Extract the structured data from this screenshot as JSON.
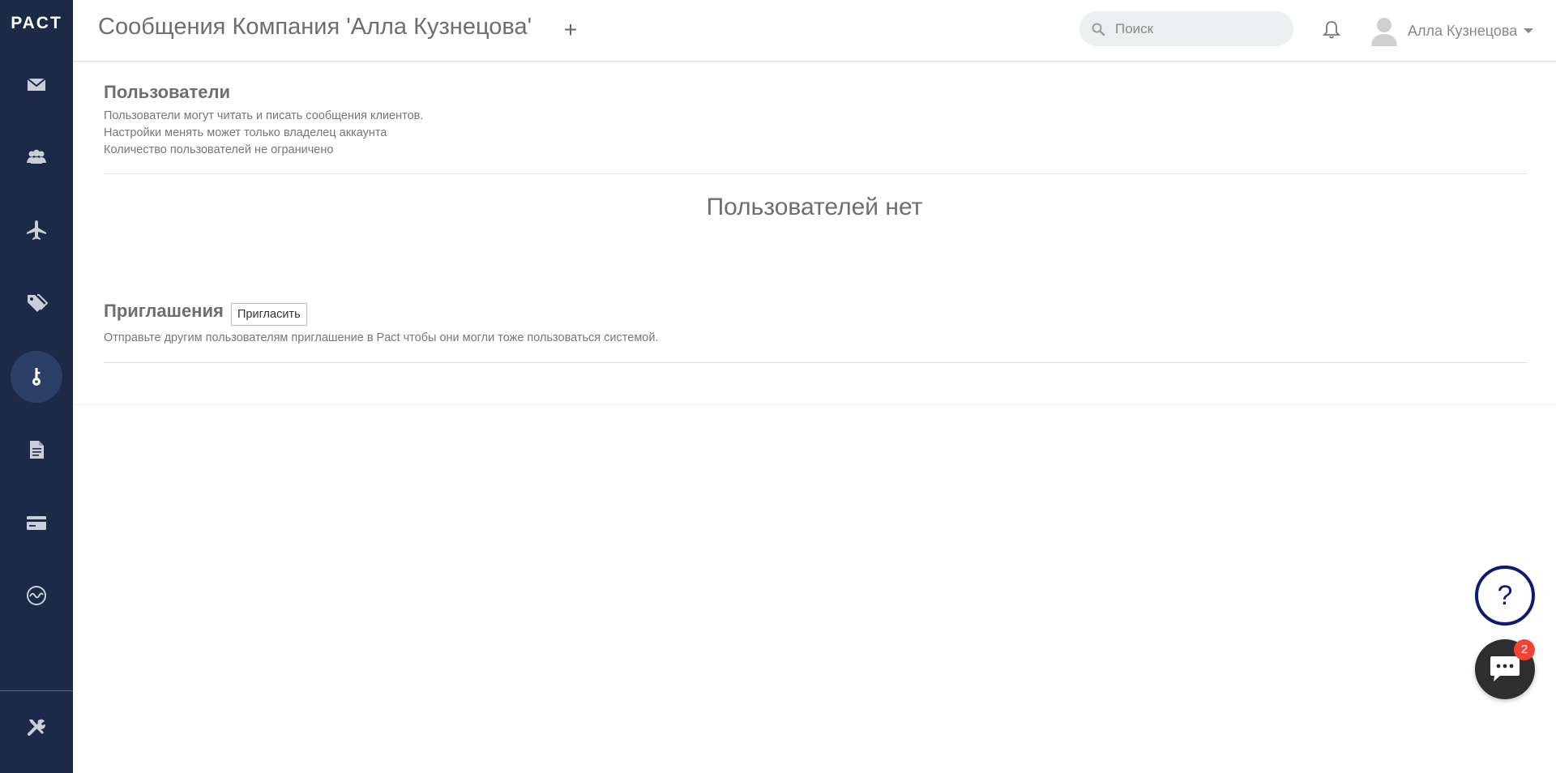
{
  "app": {
    "brand": "PACT"
  },
  "sidebar": {
    "items": [
      {
        "name": "messages",
        "icon": "envelope-icon"
      },
      {
        "name": "clients",
        "icon": "users-icon"
      },
      {
        "name": "channels",
        "icon": "airplane-icon"
      },
      {
        "name": "tags",
        "icon": "tags-icon"
      },
      {
        "name": "access",
        "icon": "key-icon",
        "active": true
      },
      {
        "name": "documents",
        "icon": "document-icon"
      },
      {
        "name": "billing",
        "icon": "credit-card-icon"
      },
      {
        "name": "analytics",
        "icon": "pulse-icon"
      }
    ],
    "bottom_item": {
      "name": "settings",
      "icon": "tools-icon"
    }
  },
  "header": {
    "title": "Сообщения Компания 'Алла Кузнецова'",
    "add_label": "+",
    "search": {
      "placeholder": "Поиск",
      "value": ""
    },
    "user_name": "Алла Кузнецова"
  },
  "users_section": {
    "title": "Пользователи",
    "description": [
      "Пользователи могут читать и писать сообщения клиентов.",
      "Настройки менять может только владелец аккаунта",
      "Количество пользователей не ограничено"
    ],
    "empty_text": "Пользователей нет"
  },
  "invites_section": {
    "title": "Приглашения",
    "invite_button": "Пригласить",
    "description": "Отправьте другим пользователям приглашение в Pact чтобы они могли тоже пользоваться системой."
  },
  "floating": {
    "help_label": "?",
    "chat_badge": "2"
  },
  "colors": {
    "sidebar_bg": "#1c2a47",
    "sidebar_active": "#2c3f66",
    "help_ring": "#0d1a72",
    "badge": "#f44336"
  }
}
